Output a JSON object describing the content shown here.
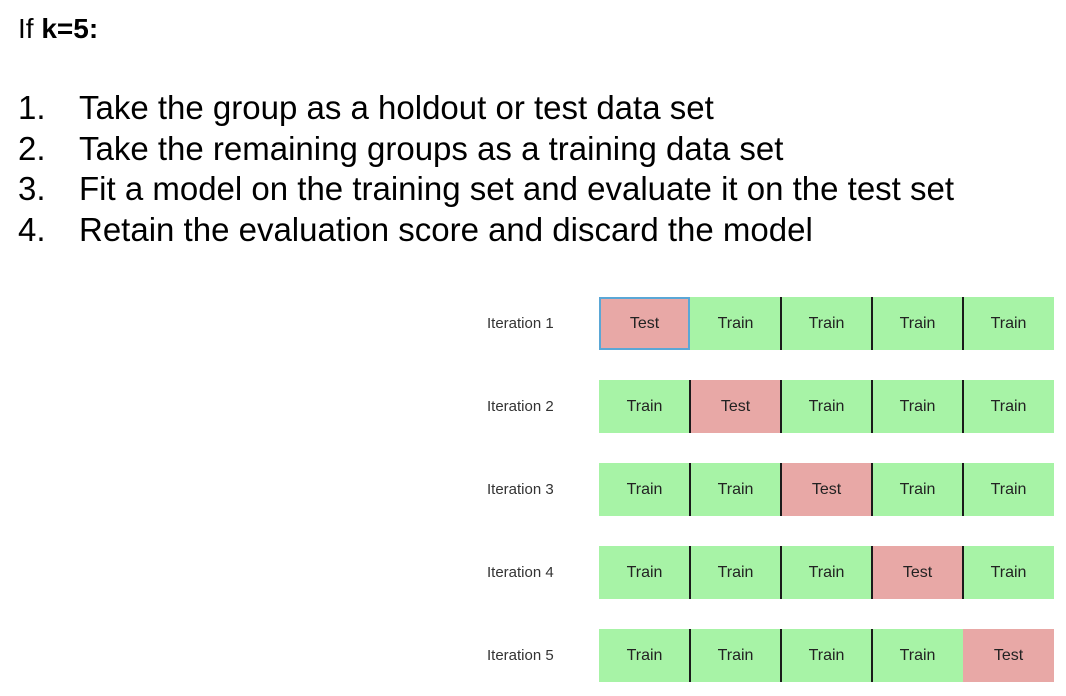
{
  "heading": {
    "prefix": "If",
    "k_label": "k=5:"
  },
  "steps": [
    {
      "number": "1.",
      "text": "Take the group as a holdout or test data set"
    },
    {
      "number": "2.",
      "text": "Take the remaining groups as a training data set"
    },
    {
      "number": "3.",
      "text": "Fit a model on the training set and evaluate it on the test set"
    },
    {
      "number": "4.",
      "text": "Retain the evaluation score and discard the model"
    }
  ],
  "diagram": {
    "colors": {
      "train": "#a7f3a6",
      "test": "#e8a8a6",
      "divider": "#1a1a1a",
      "selection_border": "#5aa7d6"
    },
    "iterations": [
      {
        "label": "Iteration 1",
        "folds": [
          "Test",
          "Train",
          "Train",
          "Train",
          "Train"
        ]
      },
      {
        "label": "Iteration 2",
        "folds": [
          "Train",
          "Test",
          "Train",
          "Train",
          "Train"
        ]
      },
      {
        "label": "Iteration 3",
        "folds": [
          "Train",
          "Train",
          "Test",
          "Train",
          "Train"
        ]
      },
      {
        "label": "Iteration 4",
        "folds": [
          "Train",
          "Train",
          "Train",
          "Test",
          "Train"
        ]
      },
      {
        "label": "Iteration 5",
        "folds": [
          "Train",
          "Train",
          "Train",
          "Train",
          "Test"
        ]
      }
    ]
  }
}
